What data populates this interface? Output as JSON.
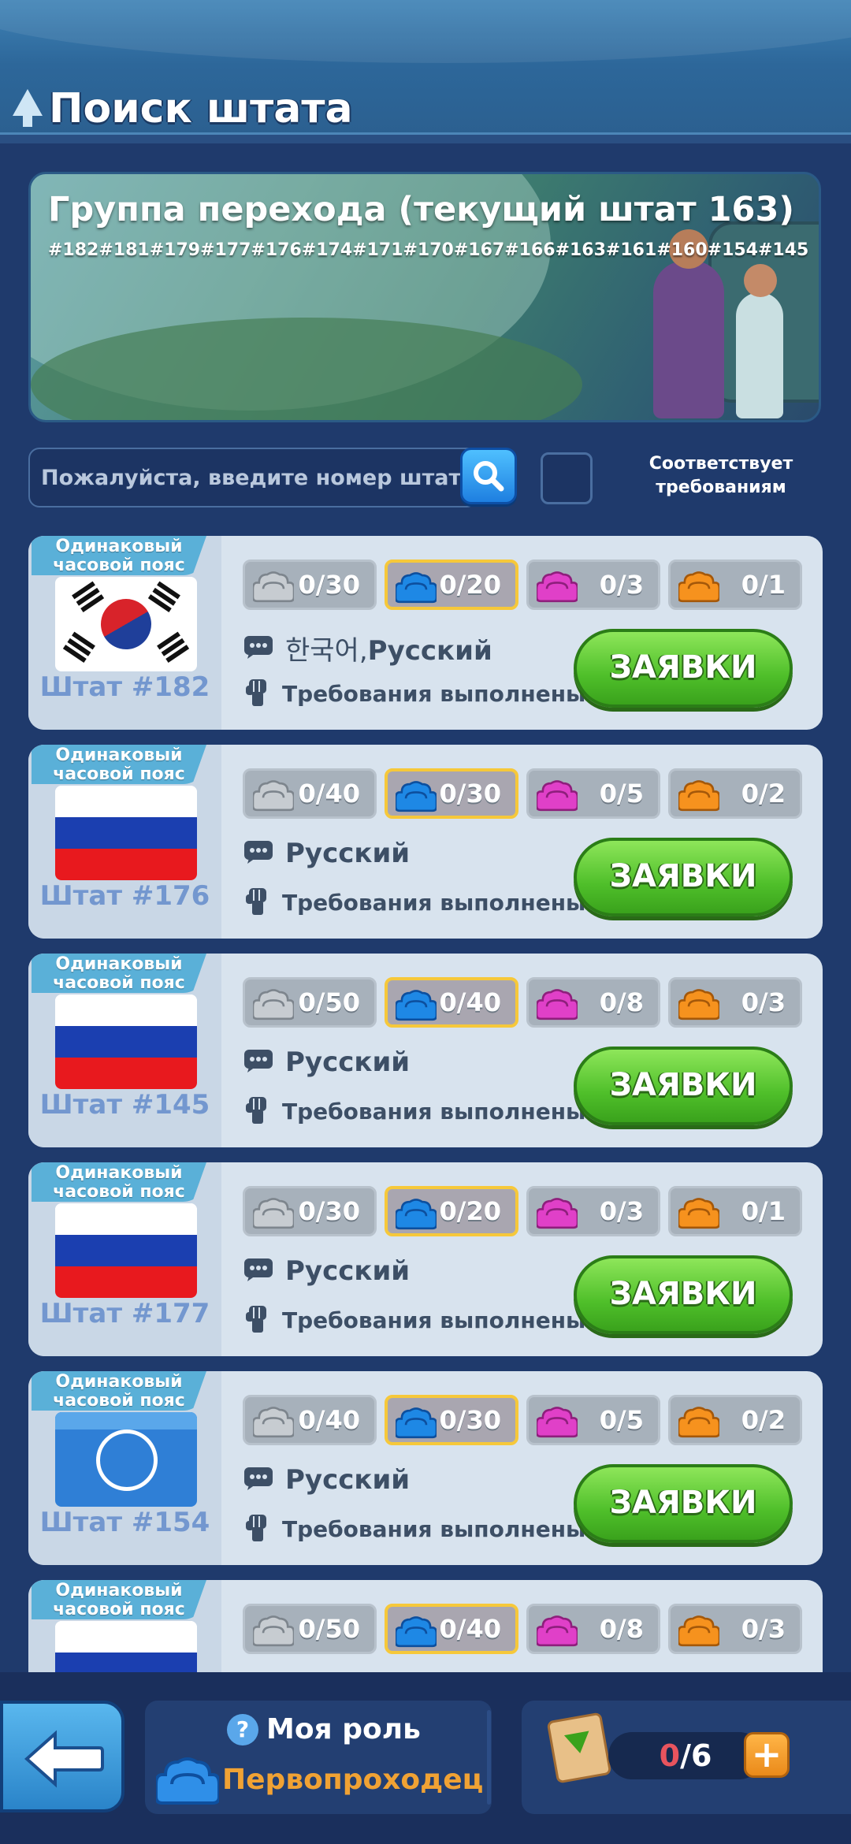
{
  "page": {
    "title": "Поиск штата"
  },
  "banner": {
    "title": "Группа перехода (текущий штат 163)",
    "states": "#182#181#179#177#176#174#171#170#167#166#163#161#160#154#145"
  },
  "search": {
    "placeholder": "Пожалуйста, введите номер штата"
  },
  "filter": {
    "label": "Соответствует требованиям",
    "checked": false
  },
  "colors": {
    "gray": "#c7ccd1",
    "blue": "#1e88e5",
    "pink": "#e040c8",
    "orange": "#f6921e",
    "apply": "#4fbf2a"
  },
  "states": [
    {
      "badge": "Одинаковый часовой пояс",
      "flag": "korea",
      "name": "Штат #182",
      "res": [
        "0/30",
        "0/20",
        "0/3",
        "0/1"
      ],
      "lang_prefix": "한국어,",
      "lang": "Русский",
      "req": "Требования выполнены",
      "apply": "ЗАЯВКИ"
    },
    {
      "badge": "Одинаковый часовой пояс",
      "flag": "russia",
      "name": "Штат #176",
      "res": [
        "0/40",
        "0/30",
        "0/5",
        "0/2"
      ],
      "lang_prefix": "",
      "lang": "Русский",
      "req": "Требования выполнены",
      "apply": "ЗАЯВКИ"
    },
    {
      "badge": "Одинаковый часовой пояс",
      "flag": "russia",
      "name": "Штат #145",
      "res": [
        "0/50",
        "0/40",
        "0/8",
        "0/3"
      ],
      "lang_prefix": "",
      "lang": "Русский",
      "req": "Требования выполнены",
      "apply": "ЗАЯВКИ"
    },
    {
      "badge": "Одинаковый часовой пояс",
      "flag": "russia",
      "name": "Штат #177",
      "res": [
        "0/30",
        "0/20",
        "0/3",
        "0/1"
      ],
      "lang_prefix": "",
      "lang": "Русский",
      "req": "Требования выполнены",
      "apply": "ЗАЯВКИ"
    },
    {
      "badge": "Одинаковый часовой пояс",
      "flag": "custom-blue",
      "name": "Штат #154",
      "res": [
        "0/40",
        "0/30",
        "0/5",
        "0/2"
      ],
      "lang_prefix": "",
      "lang": "Русский",
      "req": "Требования выполнены",
      "apply": "ЗАЯВКИ"
    },
    {
      "badge": "Одинаковый часовой пояс",
      "flag": "russia",
      "name": "",
      "res": [
        "0/50",
        "0/40",
        "0/8",
        "0/3"
      ],
      "lang_prefix": "",
      "lang": "",
      "req": "",
      "apply": ""
    }
  ],
  "bottom": {
    "role_label": "Моя роль",
    "role_value": "Первопроходец",
    "counter_current": "0",
    "counter_total": "/6",
    "plus": "+"
  }
}
